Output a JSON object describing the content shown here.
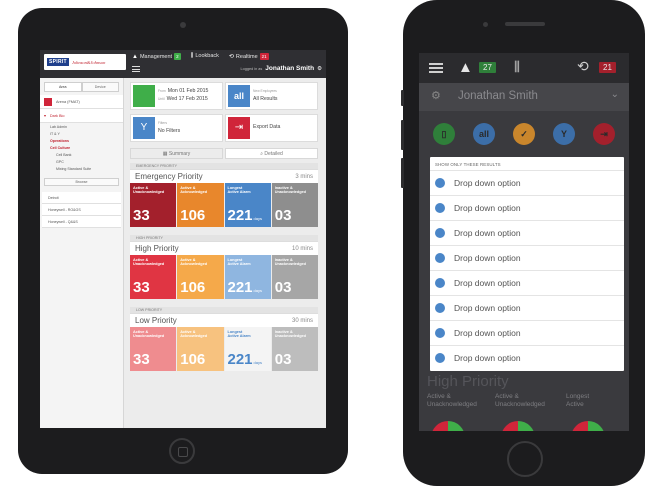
{
  "colors": {
    "red": "#d0253a",
    "green": "#3fae49",
    "blue": "#4a86c8",
    "dark_red": "#a3202c",
    "orange": "#f5a33a",
    "gray_tile": "#9b9b9b"
  },
  "tablet": {
    "logo": {
      "brand": "SPIRIT",
      "partner": "Johnson&Johnson"
    },
    "nav": {
      "management": "Management",
      "management_count": "2",
      "lookback": "Lookback",
      "realtime": "Realtime",
      "realtime_count": "21"
    },
    "user_prefix": "Logged in as",
    "user_name": "Jonathan Smith",
    "sidebar": {
      "tab_area": "Area",
      "tab_device": "Device",
      "root": "Arena (FMAT)",
      "group": "Dark Bio",
      "items": [
        "Lab Admin",
        "IT & Y",
        "Operations",
        "Cell Culture",
        "Cell Bank",
        "GPC",
        "Mixing Standard Suite"
      ],
      "browse": "Browse",
      "links": [
        "Detroit",
        "Honeywell - RO&GS",
        "Honeywell - Q&&S"
      ]
    },
    "filters": {
      "from_label": "From",
      "from_date": "Mon 01 Feb 2015",
      "to_label": "Until",
      "to_date": "Wed 17 Feb 2015",
      "all_label": "New Employees",
      "all_results": "All Results",
      "filters_label": "Filters",
      "no_filters": "No Filters",
      "export": "Export Data"
    },
    "segments": {
      "summary": "Summary",
      "detailed": "Detailed"
    },
    "priorities": [
      {
        "label": "EMERGENCY PRIORITY",
        "title": "Emergency Priority",
        "mins": "3 mins",
        "cards": [
          {
            "label1": "Active &",
            "label2": "Unacknowledged",
            "value": "33",
            "unit": "",
            "color": "#a3202c"
          },
          {
            "label1": "Active &",
            "label2": "Acknowledged",
            "value": "106",
            "unit": "",
            "color": "#e8872c"
          },
          {
            "label1": "Longest",
            "label2": "Active Alarm",
            "value": "221",
            "unit": "days",
            "color": "#4a86c8"
          },
          {
            "label1": "Inactive &",
            "label2": "Unacknowledged",
            "value": "03",
            "unit": "",
            "color": "#8e8e8e"
          }
        ]
      },
      {
        "label": "HIGH PRIORITY",
        "title": "High Priority",
        "mins": "10 mins",
        "cards": [
          {
            "label1": "Active &",
            "label2": "Unacknowledged",
            "value": "33",
            "unit": "",
            "color": "#e03543"
          },
          {
            "label1": "Active &",
            "label2": "Acknowledged",
            "value": "106",
            "unit": "",
            "color": "#f5a94a"
          },
          {
            "label1": "Longest",
            "label2": "Active Alarm",
            "value": "221",
            "unit": "days",
            "color": "#8fb6e0"
          },
          {
            "label1": "Inactive &",
            "label2": "Unacknowledged",
            "value": "03",
            "unit": "",
            "color": "#a6a6a6"
          }
        ]
      },
      {
        "label": "LOW PRIORITY",
        "title": "Low Priority",
        "mins": "30 mins",
        "cards": [
          {
            "label1": "Active &",
            "label2": "Unacknowledged",
            "value": "33",
            "unit": "",
            "color": "#ef8c8f"
          },
          {
            "label1": "Active &",
            "label2": "Acknowledged",
            "value": "106",
            "unit": "",
            "color": "#f7c27f"
          },
          {
            "label1": "Longest",
            "label2": "Active Alarm",
            "value": "221",
            "unit": "days",
            "color": "#f4f4f4"
          },
          {
            "label1": "Inactive &",
            "label2": "Unacknowledged",
            "value": "03",
            "unit": "",
            "color": "#bdbdbd"
          }
        ]
      }
    ]
  },
  "phone": {
    "badge_green": "27",
    "badge_red": "21",
    "user_name": "Jonathan Smith",
    "icon_all": "all",
    "dropdown": {
      "header": "SHOW ONLY THESE RESULTS",
      "options": [
        "Drop down option",
        "Drop down option",
        "Drop down option",
        "Drop down option",
        "Drop down option",
        "Drop down option",
        "Drop down option",
        "Drop down option"
      ]
    },
    "below": {
      "title": "High Priority",
      "col1_a": "Active &",
      "col1_b": "Unacknowledged",
      "col2_a": "Active &",
      "col2_b": "Unacknowledged",
      "col3_a": "Longest",
      "col3_b": "Active"
    }
  }
}
